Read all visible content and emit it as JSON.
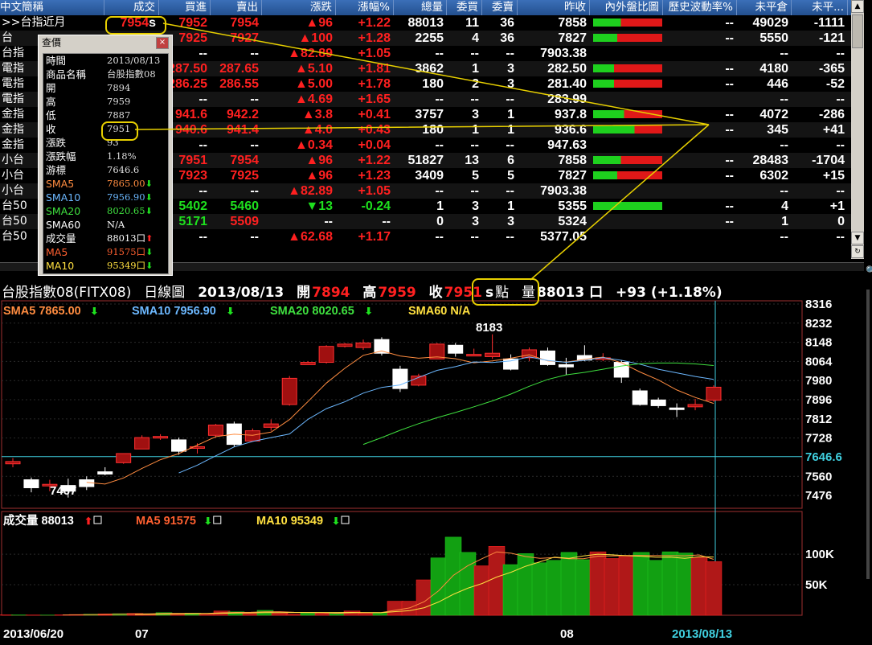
{
  "quote_table": {
    "columns": [
      "中文簡稱",
      "成交",
      "買進",
      "賣出",
      "漲跌",
      "漲幅%",
      "總量",
      "委買",
      "委賣",
      "昨收",
      "內外盤比圖",
      "歷史波動率%",
      "未平倉",
      "未平..."
    ],
    "rows": [
      {
        "name": ">>台指近月",
        "last": "7954",
        "last_suffix": "s",
        "bid": "7952",
        "ask": "7954",
        "chg": "▲96",
        "pct": "+1.22",
        "vol": "88013",
        "bq": "11",
        "aq": "36",
        "prev": "7858",
        "bar": [
          0.4,
          0.6
        ],
        "hv": "--",
        "oi": "49029",
        "oic": "-1111"
      },
      {
        "name": "台",
        "last": "",
        "bid": "7925",
        "ask": "7927",
        "chg": "▲100",
        "pct": "+1.28",
        "vol": "2255",
        "bq": "4",
        "aq": "36",
        "prev": "7827",
        "bar": [
          0.35,
          0.65
        ],
        "hv": "--",
        "oi": "5550",
        "oic": "-121"
      },
      {
        "name": "台指",
        "last": "",
        "bid": "--",
        "ask": "--",
        "chg": "▲82.89",
        "pct": "+1.05",
        "vol": "--",
        "bq": "--",
        "aq": "--",
        "prev": "7903.38",
        "bar": null,
        "hv": "",
        "oi": "--",
        "oic": "--"
      },
      {
        "name": "電指",
        "last": "",
        "bid": "287.50",
        "ask": "287.65",
        "chg": "▲5.10",
        "pct": "+1.81",
        "vol": "3862",
        "bq": "1",
        "aq": "3",
        "prev": "282.50",
        "bar": [
          0.3,
          0.7
        ],
        "hv": "--",
        "oi": "4180",
        "oic": "-365"
      },
      {
        "name": "電指",
        "last": "",
        "bid": "286.25",
        "ask": "286.55",
        "chg": "▲5.00",
        "pct": "+1.78",
        "vol": "180",
        "bq": "2",
        "aq": "3",
        "prev": "281.40",
        "bar": [
          0.3,
          0.7
        ],
        "hv": "--",
        "oi": "446",
        "oic": "-52"
      },
      {
        "name": "電指",
        "last": "",
        "bid": "--",
        "ask": "--",
        "chg": "▲4.69",
        "pct": "+1.65",
        "vol": "--",
        "bq": "--",
        "aq": "--",
        "prev": "283.99",
        "bar": null,
        "hv": "",
        "oi": "--",
        "oic": "--"
      },
      {
        "name": "金指",
        "last": "",
        "bid": "941.6",
        "ask": "942.2",
        "chg": "▲3.8",
        "pct": "+0.41",
        "vol": "3757",
        "bq": "3",
        "aq": "1",
        "prev": "937.8",
        "bar": [
          0.45,
          0.55
        ],
        "hv": "--",
        "oi": "4072",
        "oic": "-286"
      },
      {
        "name": "金指",
        "last": "",
        "bid": "940.6",
        "ask": "941.4",
        "chg": "▲4.0",
        "pct": "+0.43",
        "vol": "180",
        "bq": "1",
        "aq": "1",
        "prev": "936.6",
        "bar": [
          0.6,
          0.4
        ],
        "hv": "--",
        "oi": "345",
        "oic": "+41"
      },
      {
        "name": "金指",
        "last": "",
        "bid": "--",
        "ask": "--",
        "chg": "▲0.34",
        "pct": "+0.04",
        "vol": "--",
        "bq": "--",
        "aq": "--",
        "prev": "947.63",
        "bar": null,
        "hv": "",
        "oi": "--",
        "oic": "--"
      },
      {
        "name": "小台",
        "last": "",
        "bid": "7951",
        "ask": "7954",
        "chg": "▲96",
        "pct": "+1.22",
        "vol": "51827",
        "bq": "13",
        "aq": "6",
        "prev": "7858",
        "bar": [
          0.4,
          0.6
        ],
        "hv": "--",
        "oi": "28483",
        "oic": "-1704"
      },
      {
        "name": "小台",
        "last": "",
        "bid": "7923",
        "ask": "7925",
        "chg": "▲96",
        "pct": "+1.23",
        "vol": "3409",
        "bq": "5",
        "aq": "5",
        "prev": "7827",
        "bar": [
          0.35,
          0.65
        ],
        "hv": "--",
        "oi": "6302",
        "oic": "+15"
      },
      {
        "name": "小台",
        "last": "",
        "bid": "--",
        "ask": "--",
        "chg": "▲82.89",
        "pct": "+1.05",
        "vol": "--",
        "bq": "--",
        "aq": "--",
        "prev": "7903.38",
        "bar": null,
        "hv": "",
        "oi": "--",
        "oic": "--"
      },
      {
        "name": "台50",
        "last": "",
        "bid": "5402",
        "ask": "5460",
        "chg": "▼13",
        "pct": "-0.24",
        "vol": "1",
        "bq": "3",
        "aq": "1",
        "prev": "5355",
        "bar": [
          1,
          0
        ],
        "hv": "--",
        "oi": "4",
        "oic": "+1"
      },
      {
        "name": "台50",
        "last": "",
        "bid": "5171",
        "ask": "5509",
        "chg": "--",
        "pct": "--",
        "vol": "0",
        "bq": "3",
        "aq": "3",
        "prev": "5324",
        "bar": null,
        "hv": "--",
        "oi": "1",
        "oic": "0"
      },
      {
        "name": "台50",
        "last": "",
        "bid": "--",
        "ask": "--",
        "chg": "▲62.68",
        "pct": "+1.17",
        "vol": "--",
        "bq": "--",
        "aq": "--",
        "prev": "5377.05",
        "bar": null,
        "hv": "",
        "oi": "--",
        "oic": "--"
      }
    ]
  },
  "popup": {
    "title": "查價",
    "close": "×",
    "rows": [
      {
        "k": "時間",
        "v": "2013/08/13",
        "kc": "#ffffff",
        "vc": "#dddddd"
      },
      {
        "k": "商品名稱",
        "v": "台股指數08",
        "kc": "#ffffff",
        "vc": "#dddddd"
      },
      {
        "k": "開",
        "v": "7894",
        "kc": "#ffffff",
        "vc": "#dddddd"
      },
      {
        "k": "高",
        "v": "7959",
        "kc": "#ffffff",
        "vc": "#dddddd"
      },
      {
        "k": "低",
        "v": "7887",
        "kc": "#ffffff",
        "vc": "#dddddd"
      },
      {
        "k": "收",
        "v": "7951",
        "kc": "#ffffff",
        "vc": "#dddddd"
      },
      {
        "k": "漲跌",
        "v": "93",
        "kc": "#ffffff",
        "vc": "#dddddd"
      },
      {
        "k": "漲跌幅",
        "v": "1.18%",
        "kc": "#ffffff",
        "vc": "#dddddd"
      },
      {
        "k": "游標",
        "v": "7646.6",
        "kc": "#ffffff",
        "vc": "#dddddd"
      },
      {
        "k": "SMA5",
        "v": "7865.00",
        "kc": "#ff8c40",
        "vc": "#ff8c40",
        "arrow": "dn"
      },
      {
        "k": "SMA10",
        "v": "7956.90",
        "kc": "#6cb8ff",
        "vc": "#6cb8ff",
        "arrow": "dn"
      },
      {
        "k": "SMA20",
        "v": "8020.65",
        "kc": "#3fe03f",
        "vc": "#3fe03f",
        "arrow": "dn"
      },
      {
        "k": "SMA60",
        "v": "N/A",
        "kc": "#ffffff",
        "vc": "#ffffff"
      },
      {
        "k": "成交量",
        "v": "88013口",
        "kc": "#ffffff",
        "vc": "#ffffff",
        "arrow": "up"
      },
      {
        "k": "MA5",
        "v": "91575口",
        "kc": "#ff6030",
        "vc": "#ff6030",
        "arrow": "dn"
      },
      {
        "k": "MA10",
        "v": "95349口",
        "kc": "#ffe040",
        "vc": "#ffe040",
        "arrow": "dn"
      }
    ]
  },
  "chart_title": {
    "name": "台股指數08(FITX08)",
    "period": "日線圖",
    "date": "2013/08/13",
    "open_label": "開",
    "open": "7894",
    "high_label": "高",
    "high": "7959",
    "close_label": "收",
    "close": "7951",
    "close_suffix": "s",
    "unit": "點",
    "vol_label": "量",
    "vol": "88013 口",
    "change": "+93 (+1.18%)"
  },
  "sma_legend": [
    {
      "label": "SMA5 7865.00",
      "color": "#ff8c40",
      "arrow": "dn"
    },
    {
      "label": "SMA10 7956.90",
      "color": "#6cb8ff",
      "arrow": "dn"
    },
    {
      "label": "SMA20 8020.65",
      "color": "#3fe03f",
      "arrow": "dn"
    },
    {
      "label": "SMA60 N/A",
      "color": "#ffe040",
      "arrow": ""
    }
  ],
  "vol_legend": [
    {
      "label": "成交量 88013",
      "color": "#ffffff",
      "arrow": "up"
    },
    {
      "label": "MA5 91575",
      "color": "#ff6030",
      "arrow": "dn"
    },
    {
      "label": "MA10 95349",
      "color": "#ffe040",
      "arrow": "dn"
    }
  ],
  "colors": {
    "up": "#ff2020",
    "down": "#1ee01e",
    "candle_up": "#a01010",
    "candle_down": "#ffffff",
    "sma5": "#ff8c40",
    "sma10": "#6cb8ff",
    "sma20": "#3fe03f",
    "ma10": "#ffe040",
    "cursor": "#40d0e0"
  },
  "chart_data": [
    {
      "type": "candlestick",
      "title": "台股指數08(FITX08) 日線圖",
      "ylim": [
        7420,
        8330
      ],
      "y_ticks": [
        8316,
        8232,
        8148,
        8064,
        7980,
        7896,
        7812,
        7728,
        7560,
        7476
      ],
      "cursor_value": "7646.6",
      "x_labels": [
        "2013/06/20",
        "07",
        "08",
        "2013/08/13"
      ],
      "annotations": [
        {
          "label": "8183"
        },
        {
          "label": "7467"
        }
      ],
      "candles": [
        {
          "o": 7615,
          "h": 7640,
          "l": 7600,
          "c": 7625
        },
        {
          "o": 7545,
          "h": 7555,
          "l": 7490,
          "c": 7510
        },
        {
          "o": 7525,
          "h": 7545,
          "l": 7495,
          "c": 7525
        },
        {
          "o": 7520,
          "h": 7550,
          "l": 7467,
          "c": 7495
        },
        {
          "o": 7545,
          "h": 7560,
          "l": 7500,
          "c": 7515
        },
        {
          "o": 7580,
          "h": 7600,
          "l": 7565,
          "c": 7570
        },
        {
          "o": 7620,
          "h": 7660,
          "l": 7615,
          "c": 7660
        },
        {
          "o": 7680,
          "h": 7740,
          "l": 7680,
          "c": 7730
        },
        {
          "o": 7735,
          "h": 7745,
          "l": 7720,
          "c": 7735
        },
        {
          "o": 7720,
          "h": 7730,
          "l": 7655,
          "c": 7670
        },
        {
          "o": 7690,
          "h": 7705,
          "l": 7660,
          "c": 7690
        },
        {
          "o": 7740,
          "h": 7790,
          "l": 7730,
          "c": 7785
        },
        {
          "o": 7790,
          "h": 7800,
          "l": 7690,
          "c": 7700
        },
        {
          "o": 7715,
          "h": 7770,
          "l": 7715,
          "c": 7760
        },
        {
          "o": 7775,
          "h": 7810,
          "l": 7760,
          "c": 7790
        },
        {
          "o": 7875,
          "h": 8000,
          "l": 7870,
          "c": 7990
        },
        {
          "o": 8050,
          "h": 8065,
          "l": 8050,
          "c": 8060
        },
        {
          "o": 8060,
          "h": 8135,
          "l": 8055,
          "c": 8130
        },
        {
          "o": 8130,
          "h": 8145,
          "l": 8125,
          "c": 8140
        },
        {
          "o": 8125,
          "h": 8160,
          "l": 8115,
          "c": 8145
        },
        {
          "o": 8160,
          "h": 8170,
          "l": 8090,
          "c": 8100
        },
        {
          "o": 8030,
          "h": 8045,
          "l": 7930,
          "c": 7945
        },
        {
          "o": 7960,
          "h": 8010,
          "l": 7955,
          "c": 8000
        },
        {
          "o": 8075,
          "h": 8145,
          "l": 8075,
          "c": 8140
        },
        {
          "o": 8135,
          "h": 8145,
          "l": 8085,
          "c": 8100
        },
        {
          "o": 8095,
          "h": 8120,
          "l": 8090,
          "c": 8095
        },
        {
          "o": 8085,
          "h": 8183,
          "l": 8075,
          "c": 8100
        },
        {
          "o": 8075,
          "h": 8095,
          "l": 8025,
          "c": 8030
        },
        {
          "o": 8080,
          "h": 8125,
          "l": 8065,
          "c": 8115
        },
        {
          "o": 8110,
          "h": 8125,
          "l": 8045,
          "c": 8050
        },
        {
          "o": 8050,
          "h": 8080,
          "l": 8005,
          "c": 8040
        },
        {
          "o": 8090,
          "h": 8135,
          "l": 8065,
          "c": 8070
        },
        {
          "o": 8075,
          "h": 8100,
          "l": 8065,
          "c": 8080
        },
        {
          "o": 8060,
          "h": 8070,
          "l": 7970,
          "c": 7995
        },
        {
          "o": 7935,
          "h": 7945,
          "l": 7870,
          "c": 7875
        },
        {
          "o": 7895,
          "h": 7905,
          "l": 7860,
          "c": 7870
        },
        {
          "o": 7860,
          "h": 7880,
          "l": 7820,
          "c": 7855
        },
        {
          "o": 7865,
          "h": 7900,
          "l": 7850,
          "c": 7875
        },
        {
          "o": 7894,
          "h": 7959,
          "l": 7887,
          "c": 7951
        }
      ],
      "sma5": [
        null,
        null,
        null,
        null,
        7534,
        7526,
        7553,
        7595,
        7633,
        7660,
        7697,
        7734,
        7745,
        7740,
        7754,
        7809,
        7888,
        7969,
        8034,
        8091,
        8110,
        8088,
        8078,
        8084,
        8076,
        8058,
        8066,
        8078,
        8093,
        8066,
        8061,
        8073,
        8083,
        8058,
        8018,
        7983,
        7939,
        7906,
        7880
      ],
      "sma10": [
        null,
        null,
        null,
        null,
        null,
        null,
        null,
        null,
        null,
        7575,
        7609,
        7650,
        7689,
        7713,
        7730,
        7746,
        7810,
        7857,
        7887,
        7925,
        7950,
        7961,
        7994,
        8025,
        8041,
        8062,
        8059,
        8066,
        8084,
        8068,
        8060,
        8069,
        8081,
        8069,
        8052,
        8030,
        8014,
        7998,
        7985
      ],
      "sma20": [
        null,
        null,
        null,
        null,
        null,
        null,
        null,
        null,
        null,
        null,
        null,
        null,
        null,
        null,
        null,
        null,
        null,
        null,
        null,
        7700,
        7730,
        7762,
        7791,
        7817,
        7840,
        7865,
        7891,
        7921,
        7955,
        7985,
        8005,
        8016,
        8030,
        8044,
        8054,
        8057,
        8057,
        8053,
        8046
      ]
    },
    {
      "type": "bar",
      "title": "成交量",
      "ylim": [
        0,
        170000
      ],
      "y_ticks": [
        "100K",
        "50K"
      ],
      "values": [
        600,
        500,
        400,
        300,
        600,
        1200,
        1800,
        2200,
        2600,
        3000,
        1800,
        4200,
        3100,
        3500,
        2600,
        7000,
        5600,
        5000,
        8000,
        3500,
        1800,
        4200,
        3000,
        3500,
        7100,
        3000,
        4500,
        23000,
        23000,
        58000,
        94000,
        128000,
        103000,
        81000,
        113000,
        83000,
        101000,
        86000,
        90000,
        103000,
        91000,
        104000,
        93000,
        98000,
        103000,
        90000,
        104000,
        102000,
        95000,
        88013
      ],
      "up": [
        1,
        0,
        1,
        0,
        1,
        1,
        0,
        1,
        0,
        1,
        1,
        0,
        1,
        0,
        1,
        1,
        0,
        1,
        0,
        1,
        1,
        0,
        1,
        0,
        1,
        1,
        0,
        1,
        1,
        1,
        0,
        0,
        0,
        1,
        1,
        0,
        0,
        0,
        0,
        0,
        0,
        1,
        1,
        1,
        0,
        0,
        0,
        0,
        1,
        1
      ],
      "ma5": [
        null,
        null,
        null,
        null,
        480,
        600,
        900,
        1300,
        1840,
        2160,
        2280,
        2760,
        2940,
        2920,
        3040,
        4080,
        4560,
        4740,
        5640,
        5820,
        4780,
        4500,
        4100,
        3200,
        3920,
        4160,
        4220,
        8220,
        12120,
        22320,
        40300,
        65200,
        81200,
        92800,
        103800,
        101600,
        96200,
        93200,
        94600,
        92600,
        92600,
        96800,
        97200,
        97800,
        97800,
        97600,
        97600,
        97400,
        98800,
        91575
      ],
      "ma10": [
        null,
        null,
        null,
        null,
        null,
        null,
        null,
        null,
        null,
        1320,
        1440,
        1810,
        2080,
        2370,
        2570,
        3150,
        3530,
        3810,
        4350,
        4400,
        4520,
        4520,
        4520,
        4520,
        4650,
        4250,
        4150,
        5950,
        7450,
        12350,
        21850,
        34250,
        44250,
        52050,
        62650,
        70550,
        80200,
        87600,
        95300,
        93200,
        97200,
        100000,
        99000,
        97500,
        96700,
        95000,
        95300,
        93300,
        95800,
        95349
      ]
    }
  ]
}
